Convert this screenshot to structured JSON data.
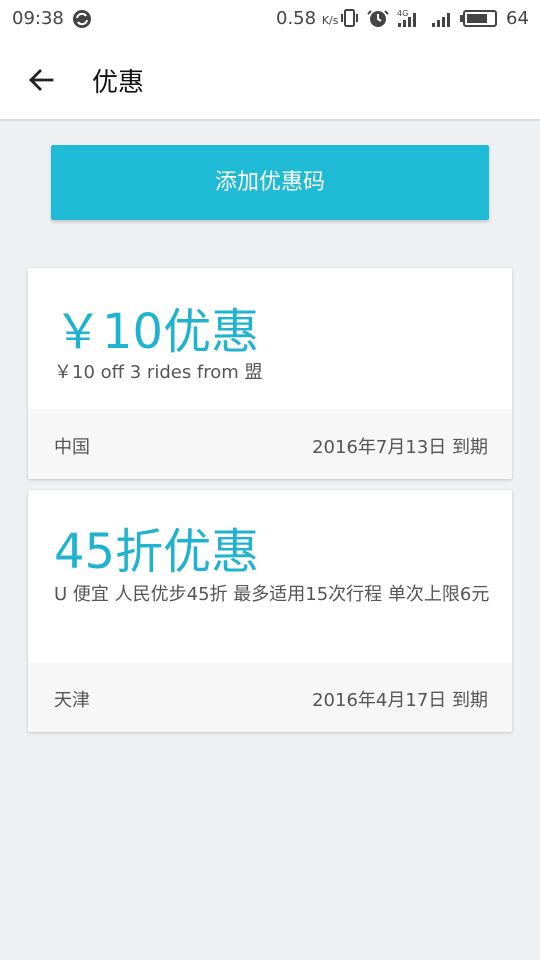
{
  "status_bar": {
    "time": "09:38",
    "network_speed": "0.58",
    "network_unit": "K/s",
    "battery_level": "64",
    "icons": [
      "sync-icon",
      "vibrate-icon",
      "alarm-icon",
      "4g-signal-icon",
      "signal-icon",
      "battery-icon"
    ]
  },
  "app_bar": {
    "title": "优惠"
  },
  "actions": {
    "add_promo_label": "添加优惠码"
  },
  "promos": [
    {
      "amount": "￥10优惠",
      "description": "￥10 off 3 rides from 盟",
      "region": "中国",
      "expiry": "2016年7月13日 到期"
    },
    {
      "amount": "45折优惠",
      "description": "U 便宜 人民优步45折 最多适用15次行程 单次上限6元",
      "region": "天津",
      "expiry": "2016年4月17日 到期"
    }
  ],
  "colors": {
    "accent": "#1fbad6",
    "background": "#eff0f2",
    "card_footer": "#f7f7f8"
  }
}
